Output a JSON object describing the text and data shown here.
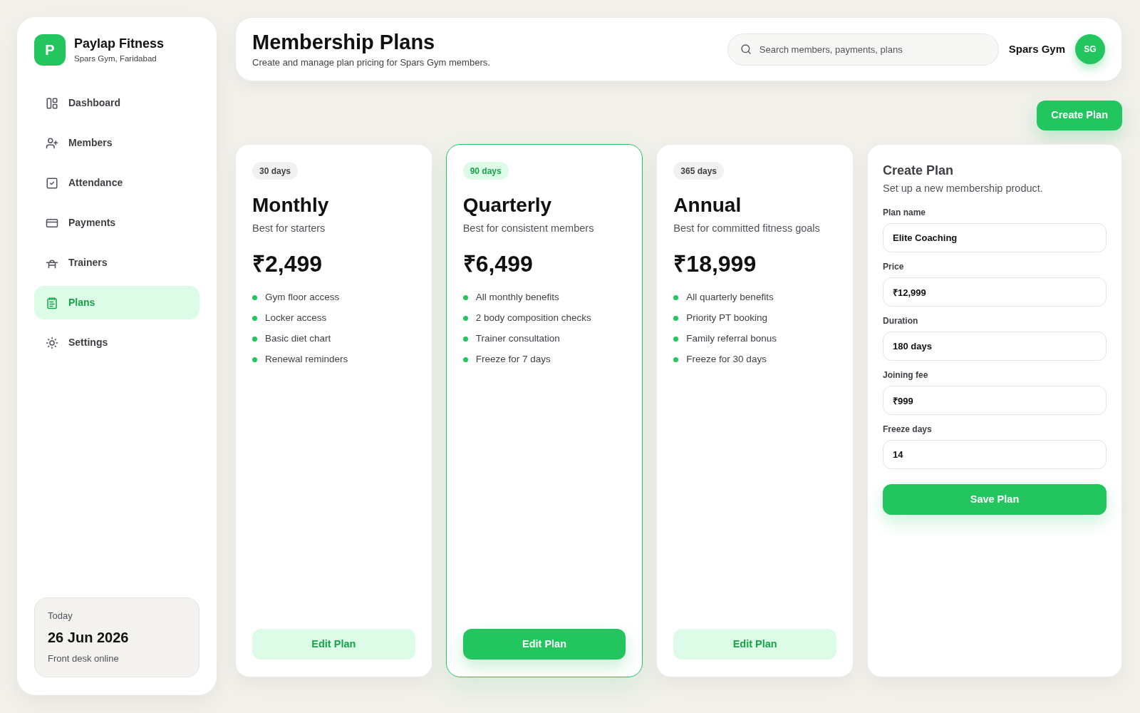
{
  "sidebar": {
    "brand": {
      "logo_letter": "P",
      "name": "Paylap Fitness",
      "location": "Spars Gym, Faridabad"
    },
    "nav_items": [
      {
        "label": "Dashboard",
        "selected": false
      },
      {
        "label": "Members",
        "selected": false
      },
      {
        "label": "Attendance",
        "selected": false
      },
      {
        "label": "Payments",
        "selected": false
      },
      {
        "label": "Trainers",
        "selected": false
      },
      {
        "label": "Plans",
        "selected": true
      },
      {
        "label": "Settings",
        "selected": false
      }
    ],
    "today_card": {
      "label": "Today",
      "date": "26 Jun 2026",
      "status": "Front desk online"
    }
  },
  "header": {
    "title": "Membership Plans",
    "subtitle": "Create and manage plan pricing for Spars Gym members.",
    "search": {
      "placeholder": "Search members, payments, plans"
    },
    "user": {
      "name": "Spars Gym",
      "initials": "SG"
    }
  },
  "create_plan_button": "Create Plan",
  "plans": [
    {
      "duration": "30 days",
      "name": "Monthly",
      "tagline": "Best for starters",
      "price": "₹2,499",
      "features": [
        "Gym floor access",
        "Locker access",
        "Basic diet chart",
        "Renewal reminders"
      ],
      "button": "Edit Plan",
      "selected": false
    },
    {
      "duration": "90 days",
      "name": "Quarterly",
      "tagline": "Best for consistent members",
      "price": "₹6,499",
      "features": [
        "All monthly benefits",
        "2 body composition checks",
        "Trainer consultation",
        "Freeze for 7 days"
      ],
      "button": "Edit Plan",
      "selected": true
    },
    {
      "duration": "365 days",
      "name": "Annual",
      "tagline": "Best for committed fitness goals",
      "price": "₹18,999",
      "features": [
        "All quarterly benefits",
        "Priority PT booking",
        "Family referral bonus",
        "Freeze for 30 days"
      ],
      "button": "Edit Plan",
      "selected": false
    }
  ],
  "form": {
    "title": "Create Plan",
    "subtitle": "Set up a new membership product.",
    "fields": [
      {
        "label": "Plan name",
        "value": "Elite Coaching"
      },
      {
        "label": "Price",
        "value": "₹12,999"
      },
      {
        "label": "Duration",
        "value": "180 days"
      },
      {
        "label": "Joining fee",
        "value": "₹999"
      },
      {
        "label": "Freeze days",
        "value": "14"
      }
    ],
    "button": "Save Plan"
  }
}
